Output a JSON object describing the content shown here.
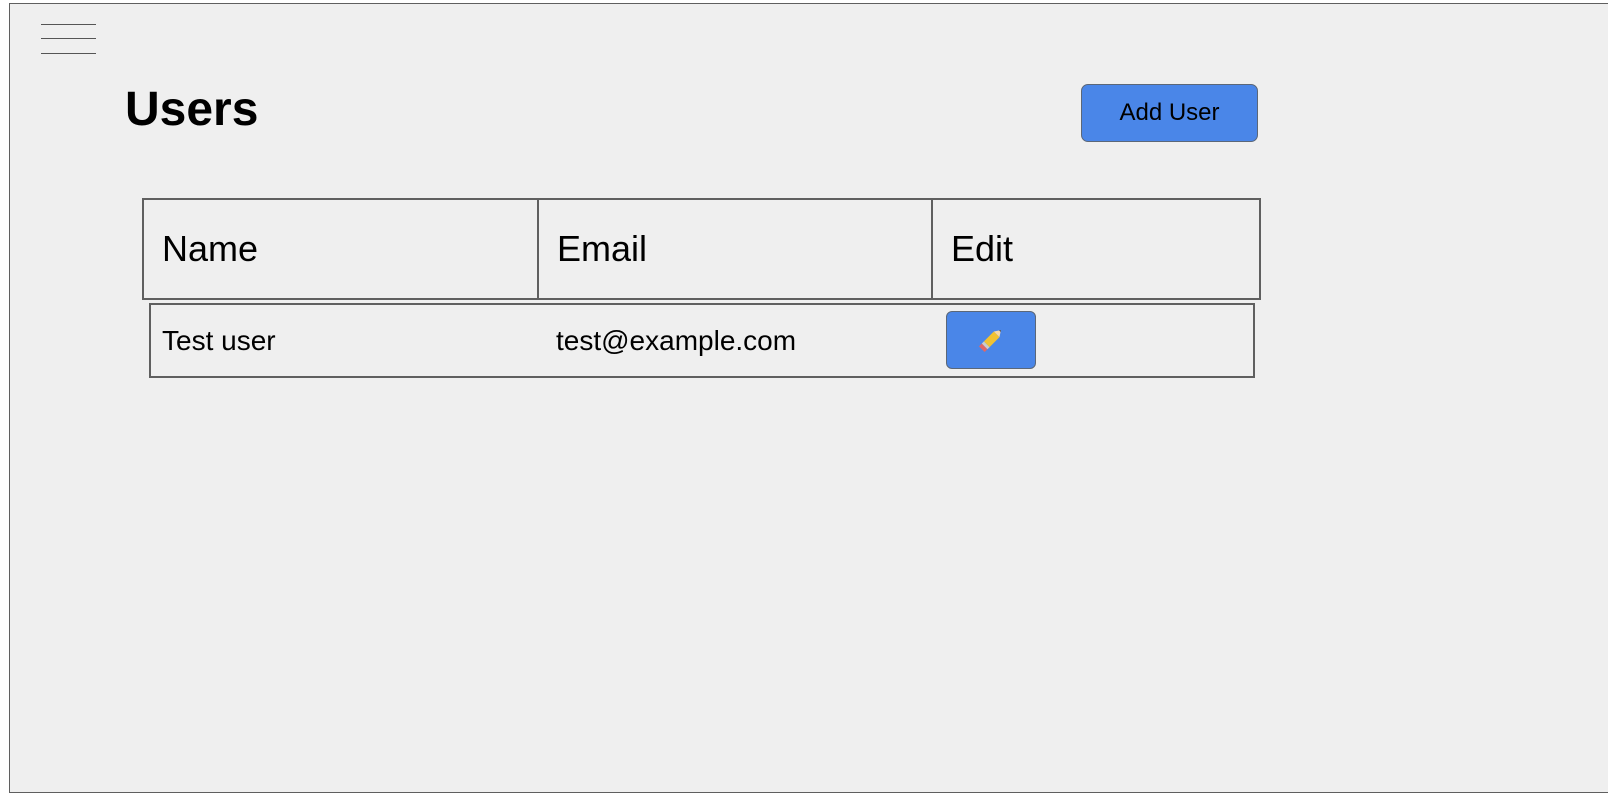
{
  "header": {
    "menu_icon": "hamburger-menu-icon",
    "title": "Users",
    "add_button_label": "Add User"
  },
  "table": {
    "columns": [
      "Name",
      "Email",
      "Edit"
    ],
    "rows": [
      {
        "name": "Test user",
        "email": "test@example.com",
        "edit_icon": "pencil-icon"
      }
    ]
  },
  "colors": {
    "background": "#efefef",
    "accent": "#4a86e8",
    "border": "#5f5f5f"
  }
}
